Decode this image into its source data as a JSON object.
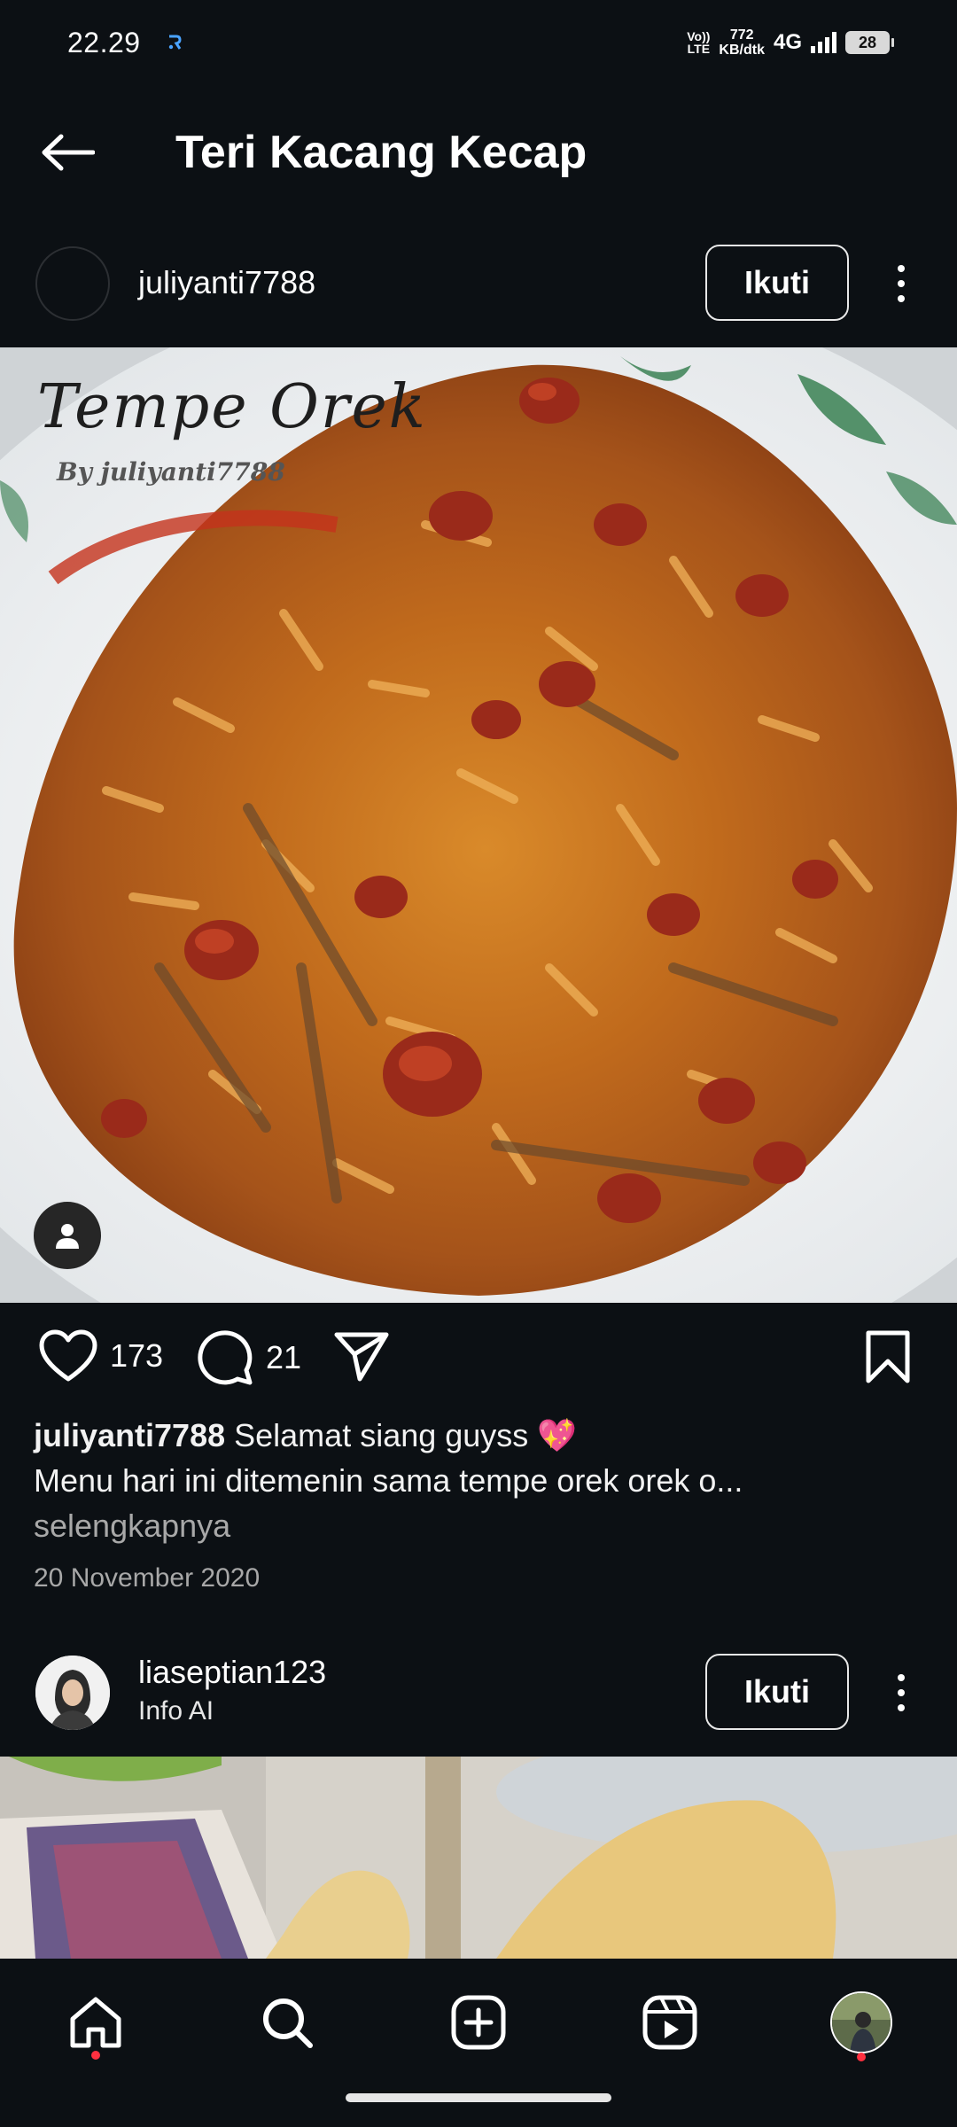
{
  "status_bar": {
    "time": "22.29",
    "volte_line1": "Vo))",
    "volte_line2": "LTE",
    "speed_value": "772",
    "speed_unit": "KB/dtk",
    "network": "4G",
    "battery": "28"
  },
  "header": {
    "title": "Teri Kacang Kecap"
  },
  "post": {
    "username": "juliyanti7788",
    "follow_label": "Ikuti",
    "image_overlay_title": "Tempe Orek",
    "image_overlay_sub": "By juliyanti7788",
    "likes": "173",
    "comments": "21",
    "caption_user": "juliyanti7788",
    "caption_line1": "Selamat siang guyss 💖",
    "caption_line2": "Menu hari ini ditemenin sama tempe orek  orek o...",
    "more_label": "selengkapnya",
    "date": "20 November 2020"
  },
  "next_post": {
    "username": "liaseptian123",
    "subtext": "Info AI",
    "follow_label": "Ikuti"
  },
  "colors": {
    "background": "#0c1014",
    "text": "#f5f5f5",
    "muted": "#a8a8a8",
    "notification_dot": "#ff3040"
  },
  "icons": {
    "back": "arrow-left-icon",
    "more": "more-vertical-icon",
    "like": "heart-icon",
    "comment": "comment-icon",
    "share": "send-icon",
    "save": "bookmark-icon",
    "tag": "person-icon",
    "home": "home-icon",
    "search": "search-icon",
    "create": "plus-square-icon",
    "reels": "reels-icon",
    "profile": "profile-avatar"
  }
}
